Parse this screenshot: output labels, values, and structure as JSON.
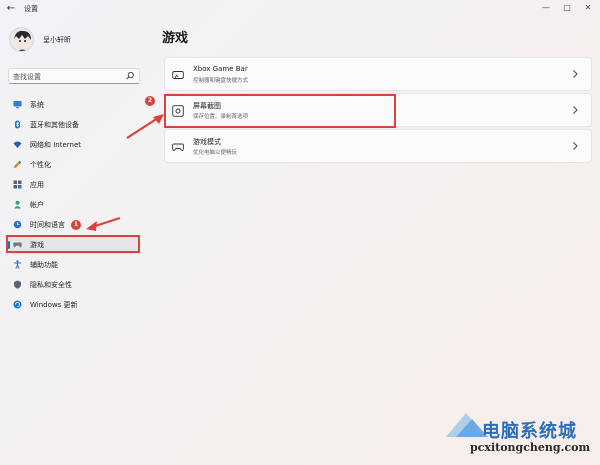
{
  "window": {
    "title": "设置",
    "back_icon": "back-arrow-icon",
    "controls": {
      "minimize": "—",
      "maximize": "□",
      "close": "✕"
    }
  },
  "profile": {
    "name": "呈小轩昕"
  },
  "search": {
    "placeholder": "查找设置"
  },
  "sidebar": {
    "items": [
      {
        "label": "系统",
        "icon": "monitor-icon",
        "color": "#2f7fd8"
      },
      {
        "label": "蓝牙和其他设备",
        "icon": "bluetooth-icon",
        "color": "#1e6ec8"
      },
      {
        "label": "网络和 Internet",
        "icon": "wifi-icon",
        "color": "#2560b8"
      },
      {
        "label": "个性化",
        "icon": "pencil-icon",
        "color": "#d08a2a"
      },
      {
        "label": "应用",
        "icon": "apps-icon",
        "color": "#55606b"
      },
      {
        "label": "帐户",
        "icon": "person-icon",
        "color": "#2fa27a"
      },
      {
        "label": "时间和语言",
        "icon": "globe-clock-icon",
        "color": "#2c72c6"
      },
      {
        "label": "游戏",
        "icon": "gamepad-icon",
        "color": "#707784",
        "active": true
      },
      {
        "label": "辅助功能",
        "icon": "accessibility-icon",
        "color": "#1e74c8"
      },
      {
        "label": "隐私和安全性",
        "icon": "shield-icon",
        "color": "#5c6670"
      },
      {
        "label": "Windows 更新",
        "icon": "update-icon",
        "color": "#1f7ad6"
      }
    ]
  },
  "main": {
    "title": "游戏",
    "cards": [
      {
        "title": "Xbox Game Bar",
        "subtitle": "控制器和键盘快捷方式",
        "icon": "game-bar-icon"
      },
      {
        "title": "屏幕截图",
        "subtitle": "保存位置、录制首选项",
        "icon": "capture-icon"
      },
      {
        "title": "游戏模式",
        "subtitle": "优化电脑以便畅玩",
        "icon": "game-mode-icon"
      }
    ]
  },
  "annotations": {
    "step1": "1",
    "step2": "2",
    "accent": "#d9443a"
  },
  "watermark": {
    "title": "电脑系统城",
    "url": "pcxitongcheng.com"
  }
}
